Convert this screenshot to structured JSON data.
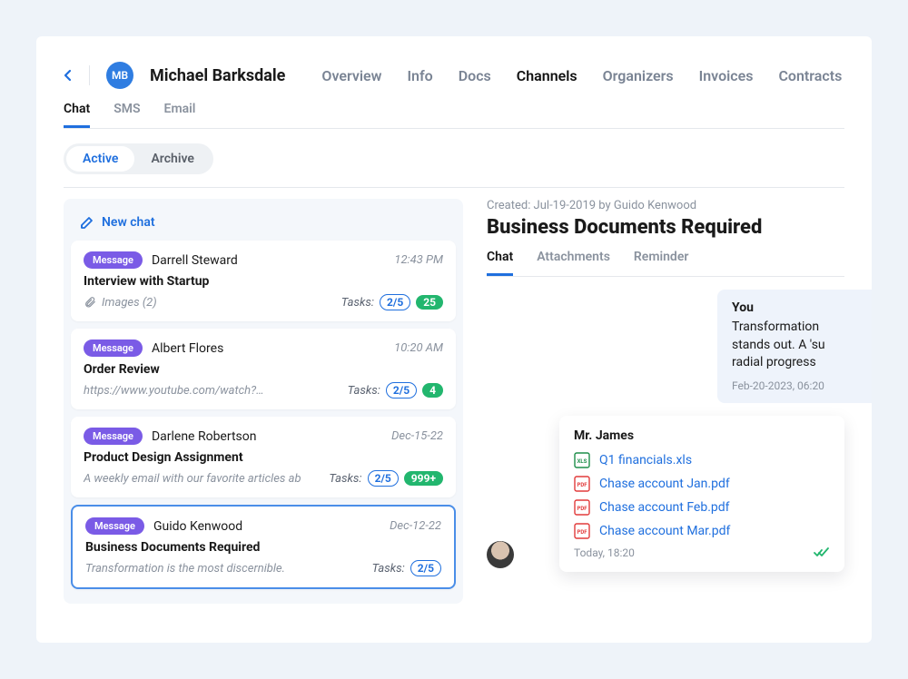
{
  "contact": {
    "initials": "MB",
    "name": "Michael Barksdale"
  },
  "topTabs": {
    "items": [
      "Overview",
      "Info",
      "Docs",
      "Channels",
      "Organizers",
      "Invoices",
      "Contracts"
    ],
    "active": "Channels"
  },
  "subTabs": {
    "items": [
      "Chat",
      "SMS",
      "Email"
    ],
    "active": "Chat"
  },
  "segControl": {
    "items": [
      "Active",
      "Archive"
    ],
    "active": "Active"
  },
  "newChatLabel": "New chat",
  "labels": {
    "message_badge": "Message",
    "tasks": "Tasks:"
  },
  "chats": [
    {
      "sender": "Darrell Steward",
      "time": "12:43 PM",
      "title": "Interview with Startup",
      "preview": "Images  (2)",
      "has_attachment": true,
      "tasks_ratio": "2/5",
      "count_badge": "25",
      "selected": false
    },
    {
      "sender": "Albert Flores",
      "time": "10:20 AM",
      "title": "Order Review",
      "preview": "https://www.youtube.com/watch?…",
      "has_attachment": false,
      "tasks_ratio": "2/5",
      "count_badge": "4",
      "selected": false
    },
    {
      "sender": "Darlene Robertson",
      "time": "Dec-15-22",
      "title": "Product Design Assignment",
      "preview": "A weekly email with our favorite articles abo…",
      "has_attachment": false,
      "tasks_ratio": "2/5",
      "count_badge": "999+",
      "selected": false
    },
    {
      "sender": "Guido Kenwood",
      "time": "Dec-12-22",
      "title": "Business Documents Required",
      "preview": "Transformation is the most discernible.",
      "has_attachment": false,
      "tasks_ratio": "2/5",
      "count_badge": "",
      "selected": true
    }
  ],
  "thread": {
    "created": "Created: Jul-19-2019 by Guido Kenwood",
    "title": "Business Documents Required",
    "tabs": {
      "items": [
        "Chat",
        "Attachments",
        "Reminder"
      ],
      "active": "Chat"
    },
    "outgoing": {
      "author": "You",
      "body": "Transformation stands out. A 'su radial progress",
      "timestamp": "Feb-20-2023, 06:20"
    },
    "incoming": {
      "author": "Mr. James",
      "files": [
        {
          "name": "Q1 financials.xls",
          "type": "xls"
        },
        {
          "name": "Chase account Jan.pdf",
          "type": "pdf"
        },
        {
          "name": "Chase account Feb.pdf",
          "type": "pdf"
        },
        {
          "name": "Chase account Mar.pdf",
          "type": "pdf"
        }
      ],
      "timestamp": "Today, 18:20",
      "read_status": "read"
    }
  }
}
